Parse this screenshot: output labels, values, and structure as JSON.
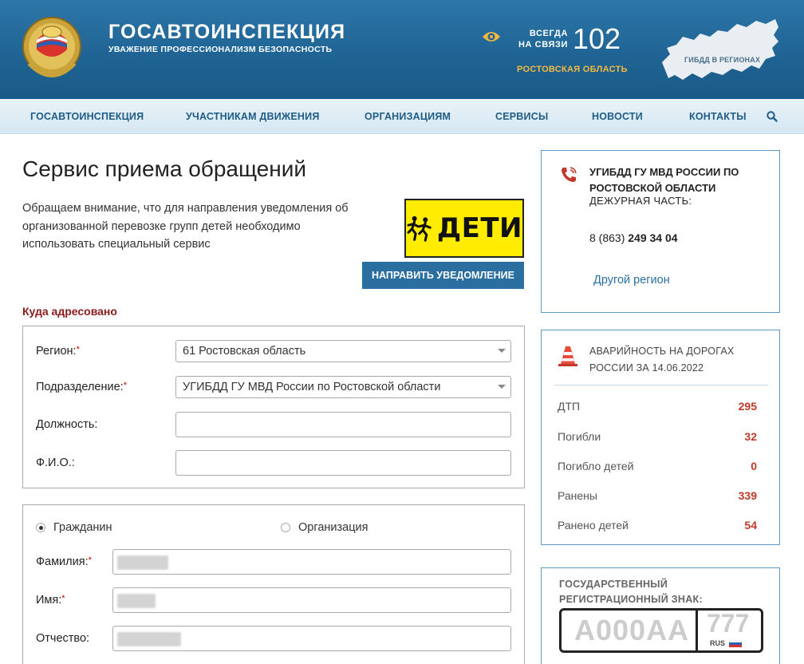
{
  "header": {
    "title": "ГОСАВТОИНСПЕКЦИЯ",
    "subtitle": "УВАЖЕНИЕ ПРОФЕССИОНАЛИЗМ БЕЗОПАСНОСТЬ",
    "always_line1": "ВСЕГДА",
    "always_line2": "НА СВЯЗИ",
    "phone": "102",
    "region": "РОСТОВСКАЯ ОБЛАСТЬ",
    "map_label": "ГИБДД В РЕГИОНАХ"
  },
  "nav": {
    "items": [
      "ГОСАВТОИНСПЕКЦИЯ",
      "УЧАСТНИКАМ ДВИЖЕНИЯ",
      "ОРГАНИЗАЦИЯМ",
      "СЕРВИСЫ",
      "НОВОСТИ",
      "КОНТАКТЫ"
    ]
  },
  "main": {
    "title": "Сервис приема обращений",
    "notice": "Обращаем внимание, что для направления уведомления об организованной перевозке групп детей необходимо использовать специальный сервис",
    "deti_label": "ДЕТИ",
    "notify_button": "НАПРАВИТЬ УВЕДОМЛЕНИЕ",
    "section_label": "Куда адресовано",
    "form1": {
      "region_label": "Регион:",
      "region_value": "61 Ростовская область",
      "division_label": "Подразделение:",
      "division_value": "УГИБДД ГУ МВД России по Ростовской области",
      "position_label": "Должность:",
      "position_value": "",
      "fio_label": "Ф.И.О.:",
      "fio_value": ""
    },
    "form2": {
      "radio_citizen": "Гражданин",
      "radio_org": "Организация",
      "selected": "Гражданин",
      "lastname_label": "Фамилия:",
      "firstname_label": "Имя:",
      "patronymic_label": "Отчество:",
      "required_mark": "*"
    }
  },
  "sidebar": {
    "contact": {
      "title": "УГИБДД ГУ МВД РОССИИ ПО РОСТОВСКОЙ ОБЛАСТИ",
      "duty": "ДЕЖУРНАЯ ЧАСТЬ:",
      "phone_prefix": "8 (863) ",
      "phone_number": "249 34 04",
      "other_region": "Другой регион"
    },
    "accidents": {
      "title_line1": "АВАРИЙНОСТЬ НА ДОРОГАХ",
      "title_line2": "РОССИИ ЗА 14.06.2022",
      "stats": [
        {
          "name": "ДТП",
          "value": "295"
        },
        {
          "name": "Погибли",
          "value": "32"
        },
        {
          "name": "Погибло детей",
          "value": "0"
        },
        {
          "name": "Ранены",
          "value": "339"
        },
        {
          "name": "Ранено детей",
          "value": "54"
        }
      ]
    },
    "plate": {
      "title_line1": "ГОСУДАРСТВЕННЫЙ",
      "title_line2": "РЕГИСТРАЦИОННЫЙ ЗНАК:",
      "number": "А000АА",
      "region": "777",
      "country": "RUS"
    }
  },
  "colors": {
    "header_blue": "#1f6494",
    "nav_text": "#1f5c87",
    "accent_gold": "#f4b942",
    "section_red": "#8b1c1c",
    "stat_red": "#c0392b",
    "button_blue": "#2a6f9f"
  }
}
